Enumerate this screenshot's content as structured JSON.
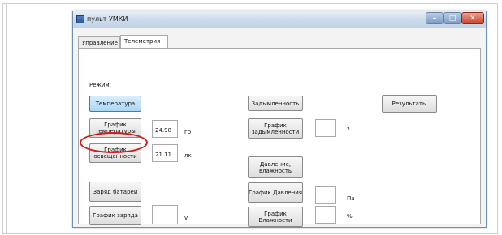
{
  "window": {
    "title": "пульт УМКИ"
  },
  "tabs": [
    {
      "label": "Управление"
    },
    {
      "label": "Телеметрия"
    }
  ],
  "mode_label": "Режим:",
  "buttons": {
    "temperature": "Температура",
    "temp_graph": "График температуры",
    "light_graph": "График освещенности",
    "battery": "Заряд батареи",
    "charge_graph": "График заряда",
    "smoke": "Задымленность",
    "smoke_graph": "График задымленности",
    "pressure_humidity": "Давление, влажность",
    "pressure_graph": "График Давления",
    "humidity_graph": "График Влажности",
    "results": "Результаты"
  },
  "fields": {
    "temperature_value": "24.98",
    "temperature_unit": "гр",
    "light_value": "21.11",
    "light_unit": "лк",
    "charge_value": "",
    "charge_unit": "v",
    "smoke_value": "",
    "smoke_unit": "?",
    "pressure_value": "",
    "pressure_unit": "Па",
    "humidity_value": "",
    "humidity_unit": "%"
  },
  "colors": {
    "highlight_circle": "#d11a1a",
    "active_button": "#a9d6f6"
  }
}
